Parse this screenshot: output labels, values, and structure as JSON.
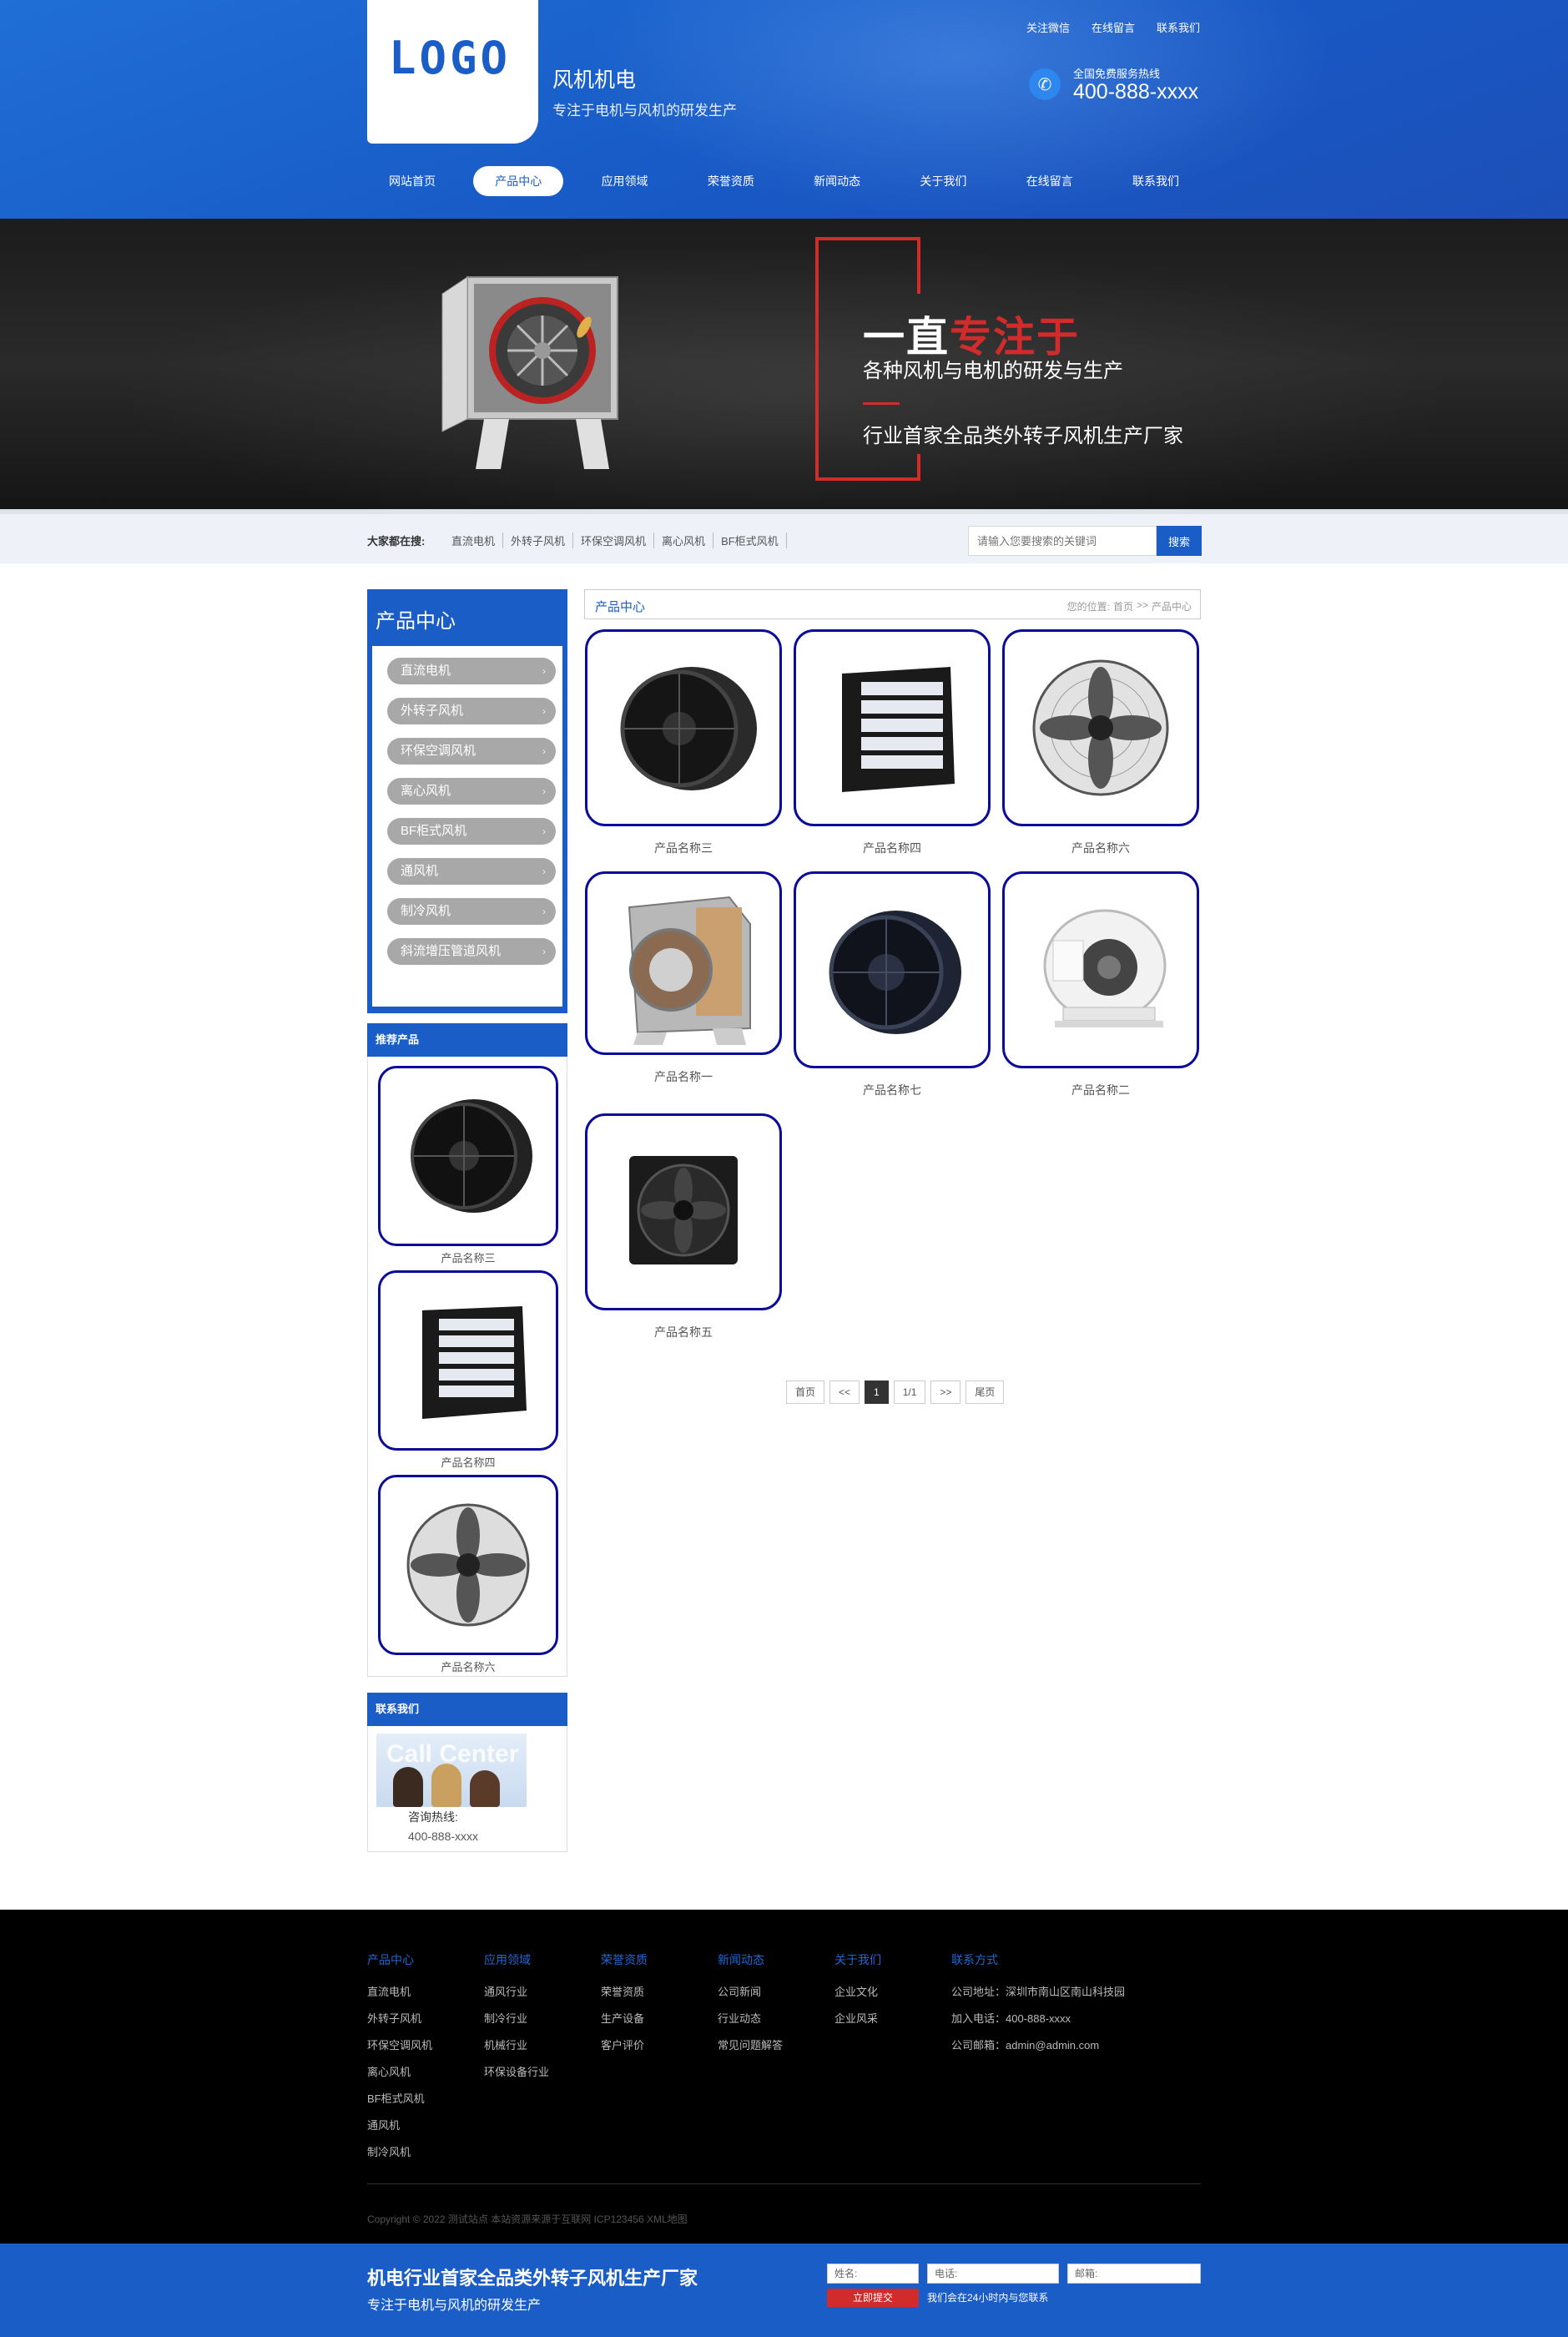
{
  "header": {
    "logo_text": "LOGO",
    "site_name": "风机机电",
    "slogan": "专注于电机与风机的研发生产",
    "top_links": [
      "关注微信",
      "在线留言",
      "联系我们"
    ],
    "hotline_label": "全国免费服务热线",
    "hotline_number": "400-888-xxxx",
    "nav": [
      {
        "label": "网站首页"
      },
      {
        "label": "产品中心",
        "active": true
      },
      {
        "label": "应用领域"
      },
      {
        "label": "荣誉资质"
      },
      {
        "label": "新闻动态"
      },
      {
        "label": "关于我们"
      },
      {
        "label": "在线留言"
      },
      {
        "label": "联系我们"
      }
    ],
    "colors": {
      "brand": "#1a5dc7",
      "accent_red": "#d22b2b",
      "frame_navy": "#0b0b9a"
    }
  },
  "banner": {
    "line1_white": "一直",
    "line1_red": "专注于",
    "line2": "各种风机与电机的研发与生产",
    "line3": "行业首家全品类外转子风机生产厂家"
  },
  "search": {
    "label": "大家都在搜:",
    "hot_words": [
      "直流电机",
      "外转子风机",
      "环保空调风机",
      "离心风机",
      "BF柜式风机"
    ],
    "placeholder": "请输入您要搜索的关键词",
    "button": "搜索"
  },
  "sidebar": {
    "category_title": "产品中心",
    "categories": [
      "直流电机",
      "外转子风机",
      "环保空调风机",
      "离心风机",
      "BF柜式风机",
      "通风机",
      "制冷风机",
      "斜流增压管道风机"
    ],
    "recommend_title": "推荐产品",
    "recommended": [
      "产品名称三",
      "产品名称四",
      "产品名称六"
    ],
    "contact_title": "联系我们",
    "contact_image_text": "Call Center",
    "contact_label": "咨询热线:",
    "contact_phone": "400-888-xxxx"
  },
  "content": {
    "title": "产品中心",
    "breadcrumb_label": "您的位置:",
    "breadcrumb_home": "首页",
    "breadcrumb_sep": ">>",
    "breadcrumb_current": "产品中心",
    "products": [
      {
        "name": "产品名称三",
        "icon": "round-axial-fan-icon"
      },
      {
        "name": "产品名称四",
        "icon": "louver-fan-icon"
      },
      {
        "name": "产品名称六",
        "icon": "grille-axial-fan-icon"
      },
      {
        "name": "产品名称一",
        "icon": "centrifugal-blower-icon"
      },
      {
        "name": "产品名称七",
        "icon": "round-axial-fan-icon"
      },
      {
        "name": "产品名称二",
        "icon": "inline-duct-fan-icon"
      },
      {
        "name": "产品名称五",
        "icon": "square-axial-fan-icon"
      }
    ],
    "pager": [
      "首页",
      "<<",
      "1",
      "1/1",
      ">>",
      "尾页"
    ]
  },
  "footer": {
    "columns": [
      {
        "title": "产品中心",
        "items": [
          "直流电机",
          "外转子风机",
          "环保空调风机",
          "离心风机",
          "BF柜式风机",
          "通风机",
          "制冷风机"
        ]
      },
      {
        "title": "应用领域",
        "items": [
          "通风行业",
          "制冷行业",
          "机械行业",
          "环保设备行业"
        ]
      },
      {
        "title": "荣誉资质",
        "items": [
          "荣誉资质",
          "生产设备",
          "客户评价"
        ]
      },
      {
        "title": "新闻动态",
        "items": [
          "公司新闻",
          "行业动态",
          "常见问题解答"
        ]
      },
      {
        "title": "关于我们",
        "items": [
          "企业文化",
          "企业风采"
        ]
      },
      {
        "title": "联系方式",
        "items": [
          "公司地址：深圳市南山区南山科技园",
          "加入电话：400-888-xxxx",
          "公司邮箱：admin@admin.com"
        ]
      }
    ],
    "copyright": "Copyright © 2022 测试站点 本站资源来源于互联网 ICP123456 XML地图"
  },
  "bottom_bar": {
    "title": "机电行业首家全品类外转子风机生产厂家",
    "subtitle": "专注于电机与风机的研发生产",
    "name_label": "姓名:",
    "phone_label": "电话:",
    "email_label": "邮箱:",
    "submit": "立即提交",
    "note": "我们会在24小时内与您联系"
  }
}
